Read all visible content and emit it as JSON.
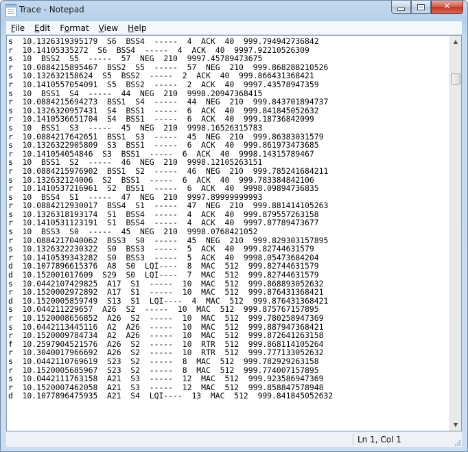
{
  "window": {
    "title": "Trace - Notepad"
  },
  "icons": {
    "app": "notepad-icon",
    "minimize": "minimize-icon",
    "maximize": "maximize-icon",
    "close": "close-icon"
  },
  "menu": [
    {
      "pre": "",
      "ul": "F",
      "post": "ile"
    },
    {
      "pre": "",
      "ul": "E",
      "post": "dit"
    },
    {
      "pre": "F",
      "ul": "o",
      "post": "rmat"
    },
    {
      "pre": "",
      "ul": "V",
      "post": "iew"
    },
    {
      "pre": "",
      "ul": "H",
      "post": "elp"
    }
  ],
  "lines": [
    "s  10.1326319395179  S6  BSS4  -----  4  ACK  40  999.794942736842",
    "r  10.14105335272  S6  BSS4  -----  4  ACK  40  9997.92210526309",
    "s  10  BSS2  S5  -----  57  NEG  210  9997.45789473675",
    "r  10.0884215895467  BSS2  S5  -----  57  NEG  210  999.868288210526",
    "s  10.132632158624  S5  BSS2  -----  2  ACK  40  999.866431368421",
    "r  10.1410557054091  S5  BSS2  -----  2  ACK  40  9997.43578947359",
    "s  10  BSS1  S4  -----  44  NEG  210  9998.20947368415",
    "r  10.0884215694273  BSS1  S4  -----  44  NEG  210  999.843701894737",
    "s  10.1326320957431  S4  BSS1  -----  6  ACK  40  999.841845052632",
    "r  10.1410536651704  S4  BSS1  -----  6  ACK  40  999.18736842099",
    "s  10  BSS1  S3  -----  45  NEG  210  9998.16526315783",
    "r  10.0884217642651  BSS1  S3  -----  45  NEG  210  999.86383031579",
    "s  10.1326322905809  S3  BSS1  -----  6  ACK  40  999.861973473685",
    "r  10.141054054846  S3  BSS1  -----  6  ACK  40  9998.14315789467",
    "s  10  BSS1  S2  -----  46  NEG  210  9998.12105263151",
    "r  10.0884215976902  BSS1  S2  -----  46  NEG  210  999.785241684211",
    "s  10.132632124006  S2  BSS1  -----  6  ACK  40  999.783384842106",
    "r  10.1410537216961  S2  BSS1  -----  6  ACK  40  9998.09894736835",
    "s  10  BSS4  S1  -----  47  NEG  210  9997.89999999993",
    "r  10.0884212930017  BSS4  S1  -----  47  NEG  210  999.881414105263",
    "s  10.1326318193174  S1  BSS4  -----  4  ACK  40  999.879557263158",
    "r  10.1410531123191  S1  BSS4  -----  4  ACK  40  9997.87789473677",
    "s  10  BSS3  S0  -----  45  NEG  210  9998.0768421052",
    "r  10.0884217040062  BSS3  S0  -----  45  NEG  210  999.829303157895",
    "s  10.1326322230322  S0  BSS3  -----  5  ACK  40  999.82744631579",
    "r  10.1410539343282  S0  BSS3  -----  5  ACK  40  9998.05473684204",
    "d  10.1077896615376  A8  S0  LQI----  8  MAC  512  999.82744631579",
    "d  10.152001017609  S29  S0  LQI----  7  MAC  512  999.82744631579",
    "s  10.0442107429825  A17  S1  -----  10  MAC  512  999.868893052632",
    "r  10.1520002972892  A17  S1  -----  10  MAC  512  999.876431368421",
    "d  10.1520005859749  S13  S1  LQI----  4  MAC  512  999.876431368421",
    "s  10.044211229657  A26  S2  -----  10  MAC  512  999.875767157895",
    "r  10.1520008656852  A26  S2  -----  10  MAC  512  999.780258947369",
    "s  10.0442113445116  A2  A26  -----  10  MAC  512  999.887947368421",
    "r  10.1520009784734  A2  A26  -----  10  MAC  512  999.872641263158",
    "f  10.2597904521576  A26  S2  -----  10  RTR  512  999.868114105264",
    "r  10.3040017966692  A26  S2  -----  10  RTR  512  999.777133052632",
    "s  10.0442110769619  S23  S2  -----  8  MAC  512  999.782929263158",
    "r  10.1520005685967  S23  S2  -----  8  MAC  512  999.774007157895",
    "s  10.0442111763158  A21  S3  -----  12  MAC  512  999.923586947369",
    "r  10.1520007462058  A21  S3  -----  12  MAC  512  999.858847578948",
    "d  10.1077896475935  A21  S4  LQI----  13  MAC  512  999.841845052632"
  ],
  "status": {
    "position": "Ln 1, Col 1"
  }
}
